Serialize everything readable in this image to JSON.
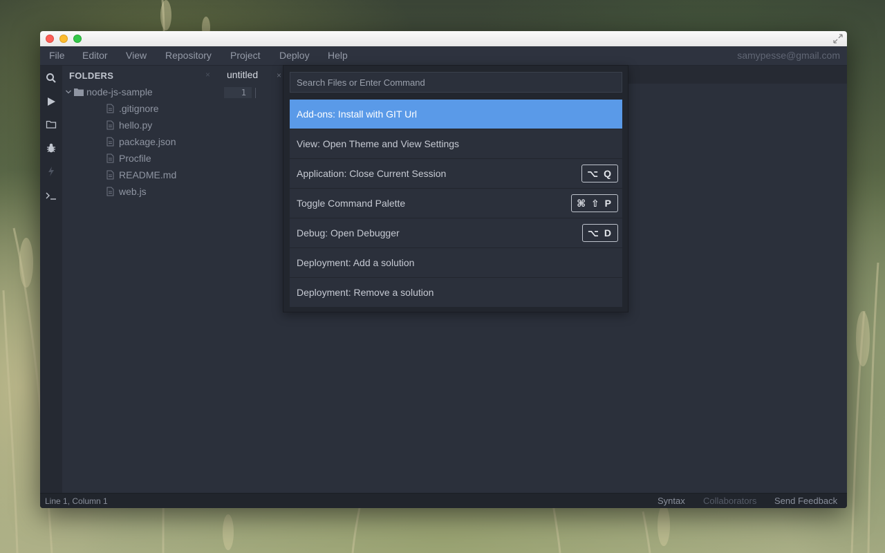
{
  "menu": {
    "items": [
      "File",
      "Editor",
      "View",
      "Repository",
      "Project",
      "Deploy",
      "Help"
    ],
    "account": "samypesse@gmail.com"
  },
  "toolbar": {
    "icons": [
      "search-icon",
      "play-icon",
      "folder-icon",
      "bug-icon",
      "lightning-icon",
      "terminal-icon"
    ]
  },
  "sidebar": {
    "title": "FOLDERS",
    "close": "×",
    "root": "node-js-sample",
    "files": [
      ".gitignore",
      "hello.py",
      "package.json",
      "Procfile",
      "README.md",
      "web.js"
    ]
  },
  "editor": {
    "tab": "untitled",
    "tab_close": "×",
    "line_number": "1"
  },
  "palette": {
    "placeholder": "Search Files or Enter Command",
    "results": [
      {
        "label": "Add-ons: Install with GIT Url",
        "shortcut": ""
      },
      {
        "label": "View: Open Theme and View Settings",
        "shortcut": ""
      },
      {
        "label": "Application: Close Current Session",
        "shortcut": "⌥ Q"
      },
      {
        "label": "Toggle Command Palette",
        "shortcut": "⌘ ⇧ P"
      },
      {
        "label": "Debug: Open Debugger",
        "shortcut": "⌥ D"
      },
      {
        "label": "Deployment: Add a solution",
        "shortcut": ""
      },
      {
        "label": "Deployment: Remove a solution",
        "shortcut": ""
      }
    ],
    "active_index": 0,
    "active_color": "#5a9ae8"
  },
  "status": {
    "position": "Line 1, Column 1",
    "syntax": "Syntax",
    "collaborators": "Collaborators",
    "feedback": "Send Feedback"
  }
}
